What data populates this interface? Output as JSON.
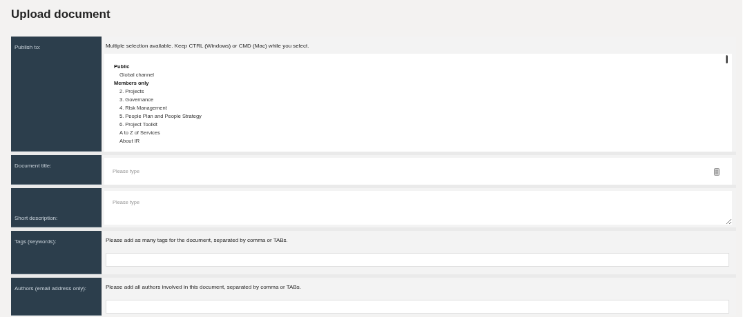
{
  "title": "Upload document",
  "publish": {
    "label": "Publish to:",
    "hint": "Multiple selection available. Keep CTRL (Windows) or CMD (Mac) while you select.",
    "groups": [
      {
        "label": "Public",
        "children": [
          {
            "label": "Global channel"
          }
        ]
      },
      {
        "label": "Members only",
        "children": [
          {
            "label": "2. Projects"
          },
          {
            "label": "3. Governance"
          },
          {
            "label": "4. Risk Management"
          },
          {
            "label": "5. People Plan and People Strategy"
          },
          {
            "label": "6. Project Toolkit"
          },
          {
            "label": "A to Z of Services"
          },
          {
            "label": "About IR"
          }
        ]
      }
    ]
  },
  "document_title": {
    "label": "Document title:",
    "placeholder": "Please type"
  },
  "short_description": {
    "label": "Short description:",
    "placeholder": "Please type"
  },
  "tags": {
    "label": "Tags (keywords):",
    "hint": "Please add as many tags for the document, separated by comma or TABs."
  },
  "authors": {
    "label": "Authors (email address only):",
    "hint": "Please add all authors involved in this document, separated by comma or TABs."
  }
}
